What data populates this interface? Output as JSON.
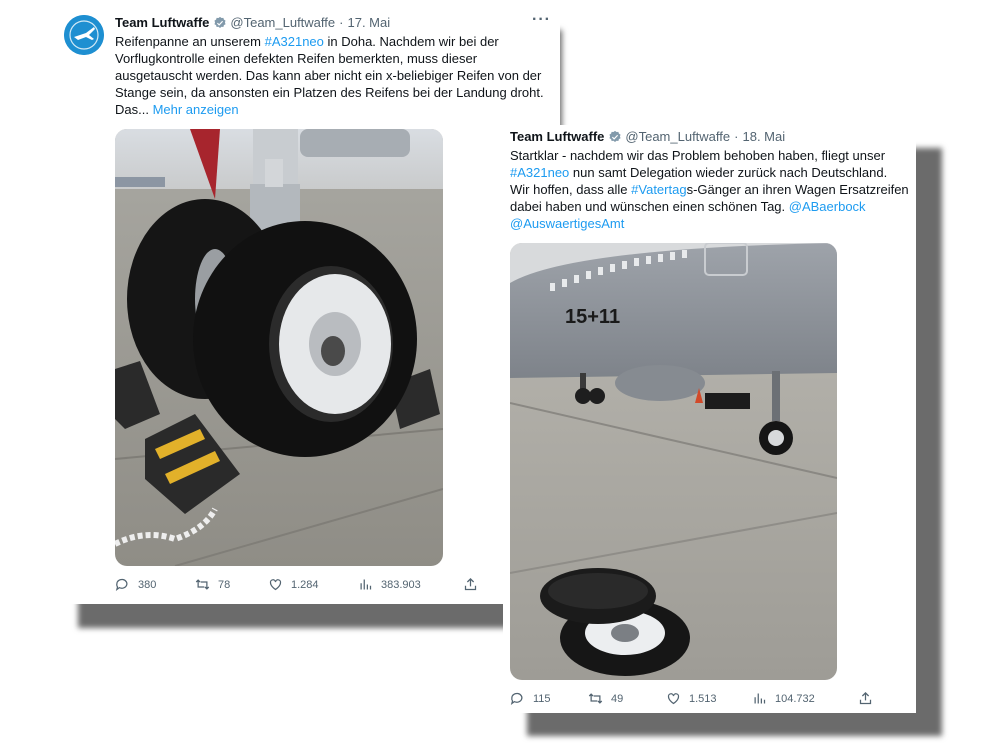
{
  "tweet1": {
    "name": "Team Luftwaffe",
    "handle": "@Team_Luftwaffe",
    "separator": "·",
    "date": "17. Mai",
    "more_icon": "···",
    "text": {
      "l1a": "Reifenpanne an unserem ",
      "l1tag": "#A321neo",
      "l1b": " in Doha. Nachdem wir bei der",
      "l2": "Vorflugkontrolle einen defekten Reifen bemerkten, muss dieser",
      "l3": "ausgetauscht werden. Das kann aber nicht ein x-beliebiger Reifen von der",
      "l4": "Stange sein, da ansonsten ein Platzen des Reifens bei der Landung droht.",
      "l5a": "Das... ",
      "l5more": "Mehr anzeigen"
    },
    "stats": {
      "replies": "380",
      "retweets": "78",
      "likes": "1.284",
      "views": "383.903"
    }
  },
  "tweet2": {
    "name": "Team Luftwaffe",
    "handle": "@Team_Luftwaffe",
    "separator": "·",
    "date": "18. Mai",
    "text": {
      "l1": "Startklar - nachdem wir das Problem behoben haben, fliegt unser",
      "l2tag": "#A321neo",
      "l2b": " nun samt Delegation wieder zurück nach Deutschland.",
      "l3a": "Wir hoffen, dass alle ",
      "l3tag": "#Vatertag",
      "l3b": "s-Gänger an ihren Wagen Ersatzreifen",
      "l4a": "dabei haben und wünschen einen schönen Tag. ",
      "l4mention": "@ABaerbock",
      "l5mention": "@AuswaertigesAmt"
    },
    "stats": {
      "replies": "115",
      "retweets": "49",
      "likes": "1.513",
      "views": "104.732"
    },
    "aircraft_marking": "15+11"
  },
  "colors": {
    "link": "#1d9bf0",
    "secondary": "#536471",
    "verified": "#829aab",
    "avatar": "#1e8fd1"
  }
}
